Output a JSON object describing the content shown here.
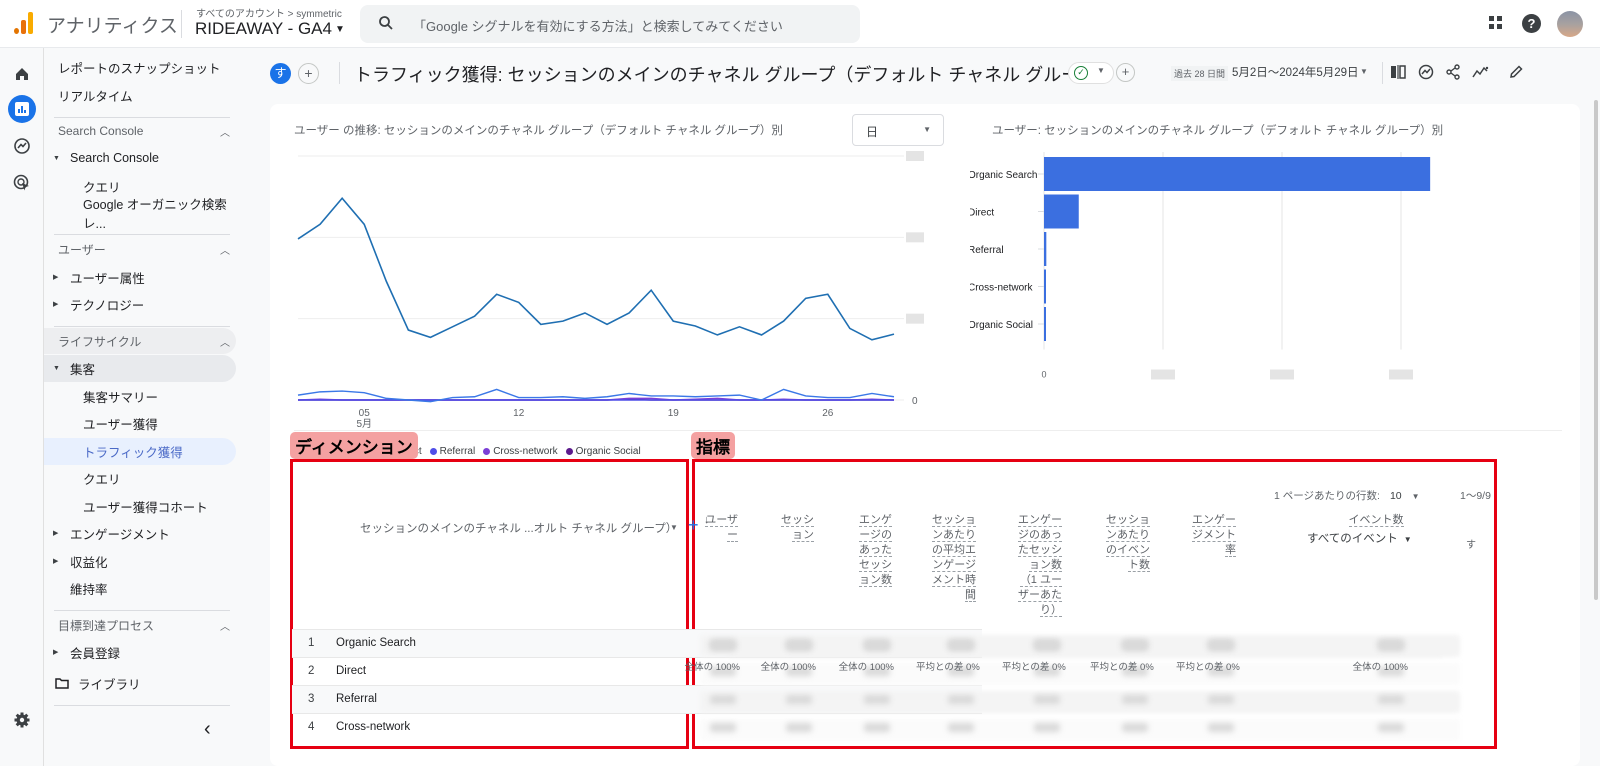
{
  "topbar": {
    "app_name": "アナリティクス",
    "account_path": "すべてのアカウント > symmetric",
    "property_name": "RIDEAWAY - GA4",
    "search_placeholder": "「Google シグナルを有効にする方法」と検索してみてください",
    "icons": [
      "apps-icon",
      "help-icon",
      "avatar"
    ]
  },
  "rail": {
    "items": [
      {
        "name": "home-icon",
        "active": false
      },
      {
        "name": "reports-icon",
        "active": true
      },
      {
        "name": "explore-icon",
        "active": false
      },
      {
        "name": "advertising-icon",
        "active": false
      }
    ],
    "settings_icon": "gear-icon"
  },
  "sidenav": {
    "items": [
      {
        "label": "レポートのスナップショット",
        "level": 0
      },
      {
        "label": "リアルタイム",
        "level": 0
      },
      {
        "label": "Search Console",
        "type": "section"
      },
      {
        "label": "Search Console",
        "level": 1,
        "expanded": true
      },
      {
        "label": "クエリ",
        "level": 2
      },
      {
        "label": "Google オーガニック検索レ...",
        "level": 2
      },
      {
        "label": "ユーザー",
        "type": "section"
      },
      {
        "label": "ユーザー属性",
        "level": 1,
        "expanded": false
      },
      {
        "label": "テクノロジー",
        "level": 1,
        "expanded": false
      },
      {
        "label": "ライフサイクル",
        "type": "section"
      },
      {
        "label": "集客",
        "level": 1,
        "expanded": true
      },
      {
        "label": "集客サマリー",
        "level": 2
      },
      {
        "label": "ユーザー獲得",
        "level": 2
      },
      {
        "label": "トラフィック獲得",
        "level": 2,
        "selected": true
      },
      {
        "label": "クエリ",
        "level": 2
      },
      {
        "label": "ユーザー獲得コホート",
        "level": 2
      },
      {
        "label": "エンゲージメント",
        "level": 1,
        "expanded": false
      },
      {
        "label": "収益化",
        "level": 1,
        "expanded": false
      },
      {
        "label": "維持率",
        "level": 1
      },
      {
        "label": "目標到達プロセス",
        "type": "section"
      },
      {
        "label": "会員登録",
        "level": 1,
        "expanded": false
      },
      {
        "label": "ライブラリ",
        "level": 0,
        "icon": "folder-icon"
      }
    ],
    "collapse_label": "‹"
  },
  "report": {
    "segment_badge": "す",
    "title": "トラフィック獲得: セッションのメインのチャネル グループ（デフォルト チャネル グループ）",
    "date_chip": "過去 28 日間",
    "date_range": "5月2日～2024年5月29日",
    "tools": [
      "compare-icon",
      "insights-icon",
      "share-icon",
      "trend-icon",
      "edit-icon"
    ]
  },
  "line_chart_panel": {
    "title": "ユーザー の推移: セッションのメインのチャネル グループ（デフォルト チャネル グループ）別",
    "granularity": "日"
  },
  "bar_chart_panel": {
    "title": "ユーザー: セッションのメインのチャネル グループ（デフォルト チャネル グループ）別"
  },
  "chart_data": [
    {
      "type": "line",
      "title": "ユーザー の推移: セッションのメインのチャネル グループ（デフォルト チャネル グループ）別",
      "xlabel": "",
      "ylabel": "",
      "x_tick_labels": [
        "05\n5月",
        "12",
        "19",
        "26"
      ],
      "x_days": [
        2,
        3,
        4,
        5,
        6,
        7,
        8,
        9,
        10,
        11,
        12,
        13,
        14,
        15,
        16,
        17,
        18,
        19,
        20,
        21,
        22,
        23,
        24,
        25,
        26,
        27,
        28,
        29
      ],
      "y_tick_labels_note": "y-axis tick labels are blurred; values below are relative (0 baseline, top gridline = 3)",
      "ylim": [
        0,
        3
      ],
      "grid": true,
      "legend_position": "bottom-left",
      "series": [
        {
          "name": "Organic Search",
          "color": "#1f6fb2",
          "values": [
            1.98,
            2.16,
            2.48,
            2.16,
            1.46,
            0.86,
            0.77,
            0.9,
            1.03,
            1.3,
            1.2,
            0.93,
            0.97,
            1.07,
            0.93,
            1.07,
            1.35,
            0.97,
            0.91,
            0.8,
            0.9,
            0.8,
            0.97,
            1.25,
            1.3,
            0.88,
            0.74,
            0.81
          ]
        },
        {
          "name": "Direct",
          "color": "#3b78e7",
          "values": [
            0.06,
            0.1,
            0.11,
            0.09,
            0.02,
            0.0,
            -0.02,
            0.03,
            0.04,
            0.13,
            0.03,
            0.03,
            0.04,
            0.02,
            0.04,
            0.08,
            0.05,
            0.05,
            0.04,
            0.05,
            0.06,
            0.0,
            0.13,
            0.05,
            0.03,
            0.03,
            0.08,
            0.04
          ]
        },
        {
          "name": "Referral",
          "color": "#4f4ee8",
          "values": [
            0.0,
            0.0,
            0.0,
            0.0,
            0.0,
            0.0,
            0.0,
            0.0,
            0.0,
            0.0,
            0.0,
            0.0,
            0.0,
            0.0,
            0.0,
            0.0,
            0.0,
            0.0,
            0.0,
            0.0,
            0.0,
            0.0,
            0.0,
            0.0,
            0.0,
            0.0,
            0.0,
            0.0
          ]
        },
        {
          "name": "Cross-network",
          "color": "#7b3fd6",
          "values": [
            0.0,
            0.01,
            0.0,
            0.0,
            0.0,
            0.0,
            0.0,
            0.0,
            0.0,
            0.0,
            0.0,
            0.0,
            0.0,
            0.0,
            0.0,
            0.02,
            0.02,
            0.0,
            0.01,
            0.02,
            0.0,
            0.0,
            0.01,
            0.0,
            0.0,
            0.0,
            0.01,
            0.0
          ]
        },
        {
          "name": "Organic Social",
          "color": "#5c1a8c",
          "values": [
            0.0,
            0.0,
            0.0,
            0.0,
            0.0,
            0.0,
            0.0,
            0.0,
            0.0,
            0.0,
            0.0,
            0.0,
            0.0,
            0.0,
            0.0,
            0.01,
            0.0,
            0.0,
            0.0,
            0.0,
            0.0,
            0.0,
            0.0,
            0.0,
            0.0,
            0.0,
            0.0,
            0.0
          ]
        }
      ]
    },
    {
      "type": "bar",
      "orientation": "horizontal",
      "title": "ユーザー: セッションのメインのチャネル グループ（デフォルト チャネル グループ）別",
      "categories": [
        "Organic Search",
        "Direct",
        "Referral",
        "Cross-network",
        "Organic Social"
      ],
      "values_note": "x-axis tick labels blurred except 0; values relative to Organic Search = 100",
      "values": [
        100,
        9,
        0.6,
        0.5,
        0.5
      ],
      "x_tick_labels": [
        "0",
        "",
        "",
        ""
      ],
      "xlim": [
        0,
        105
      ],
      "color": "#3b6fe0",
      "grid": true
    }
  ],
  "table": {
    "dimension_tag": "ディメンション",
    "metrics_tag": "指標",
    "rows_per_page_label": "1 ページあたりの行数:",
    "rows_per_page": "10",
    "pagination": "1～9/9",
    "dimension_header": "セッションのメインのチャネル ...オルト チャネル グループ）",
    "metric_headers": [
      {
        "lines": [
          "ユーザ",
          "ー"
        ]
      },
      {
        "lines": [
          "セッシ",
          "ョン"
        ]
      },
      {
        "lines": [
          "エンゲ",
          "ージの",
          "あった",
          "セッシ",
          "ョン数"
        ]
      },
      {
        "lines": [
          "セッショ",
          "ンあたり",
          "の平均エ",
          "ンゲージ",
          "メント時",
          "間"
        ]
      },
      {
        "lines": [
          "エンゲー",
          "ジのあっ",
          "たセッシ",
          "ョン数",
          "（1 ユー",
          "ザーあた",
          "り）"
        ]
      },
      {
        "lines": [
          "セッショ",
          "ンあたり",
          "のイベン",
          "ト数"
        ]
      },
      {
        "lines": [
          "エンゲー",
          "ジメント",
          "率"
        ]
      },
      {
        "lines": [
          "イベント数"
        ]
      }
    ],
    "event_filter": "すべてのイベント",
    "cut_column_label": "す",
    "totals_footnotes": [
      "全体の 100%",
      "全体の 100%",
      "全体の 100%",
      "平均との差 0%",
      "平均との差 0%",
      "平均との差 0%",
      "平均との差 0%",
      "全体の 100%"
    ],
    "rows": [
      {
        "index": "1",
        "name": "Organic Search"
      },
      {
        "index": "2",
        "name": "Direct"
      },
      {
        "index": "3",
        "name": "Referral"
      },
      {
        "index": "4",
        "name": "Cross-network"
      }
    ]
  }
}
